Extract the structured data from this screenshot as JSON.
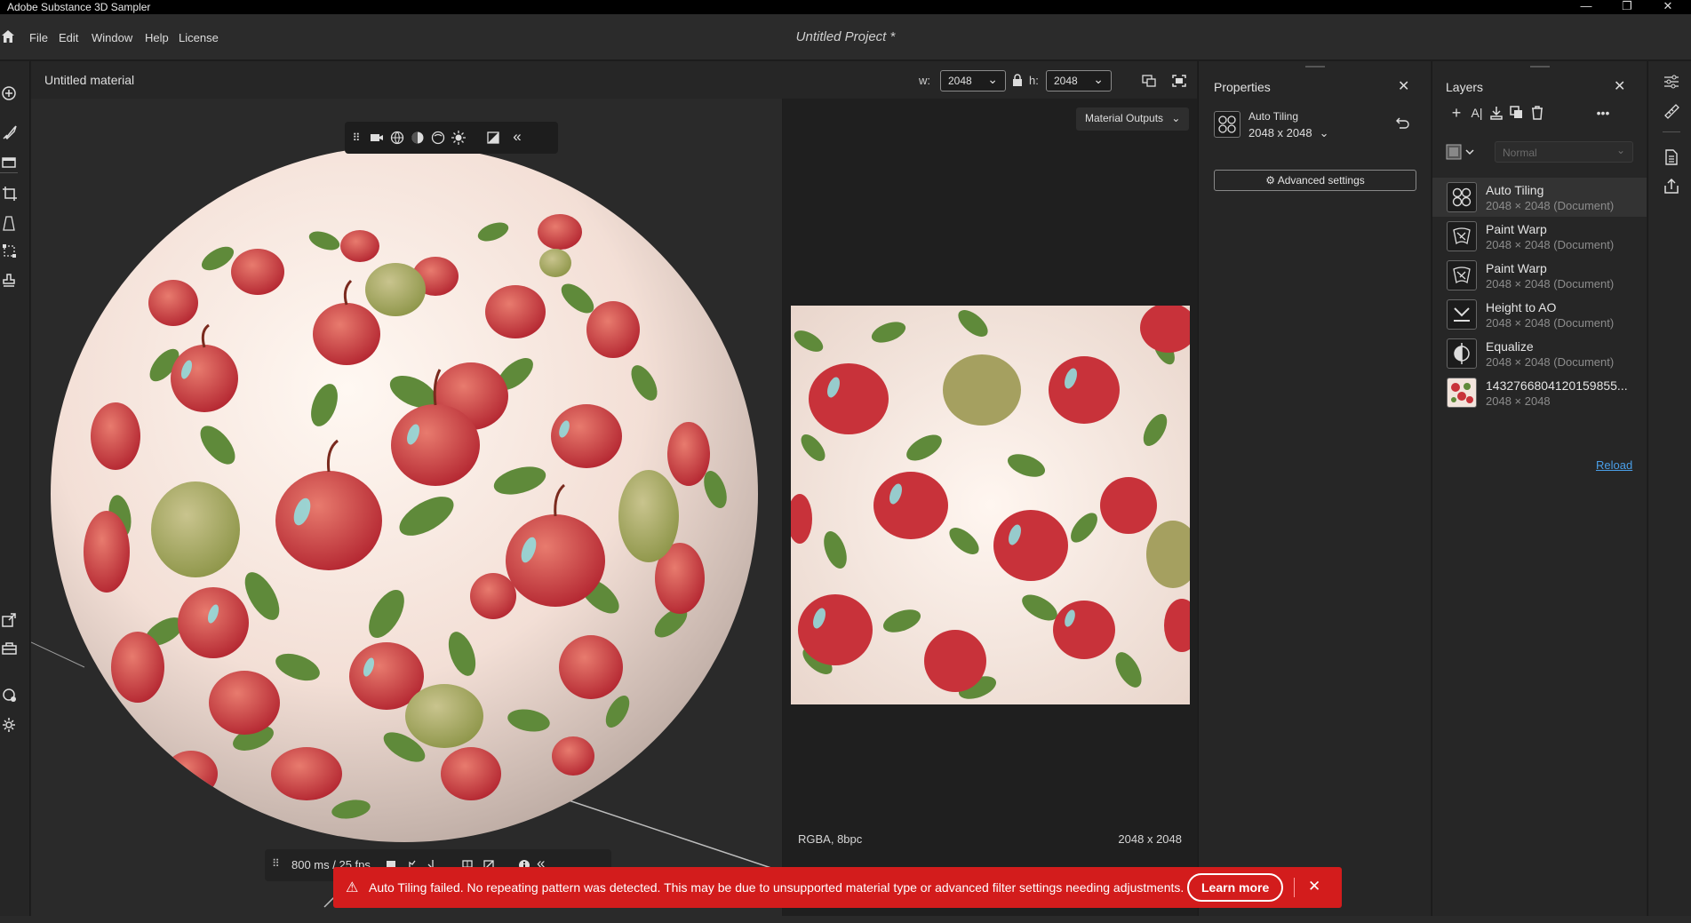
{
  "app": {
    "title": "Adobe Substance 3D Sampler",
    "project_title": "Untitled Project *"
  },
  "window_controls": {
    "minimize": "—",
    "restore": "❐",
    "close": "✕"
  },
  "menu": {
    "items": [
      "File",
      "Edit",
      "Window",
      "Help",
      "License"
    ]
  },
  "viewport": {
    "material_title": "Untitled material",
    "width_label": "w:",
    "width_value": "2048",
    "height_label": "h:",
    "height_value": "2048",
    "fps_readout": "800 ms / 25 fps",
    "collapse_symbol": "«"
  },
  "view2d": {
    "material_outputs": "Material Outputs",
    "format": "RGBA, 8bpc",
    "resolution": "2048 x 2048"
  },
  "properties": {
    "title": "Properties",
    "filter_name": "Auto Tiling",
    "filter_size": "2048 x 2048",
    "advanced_label": "Advanced settings"
  },
  "layers": {
    "title": "Layers",
    "blend_mode": "Normal",
    "items": [
      {
        "name": "Auto Tiling",
        "sub": "2048 × 2048 (Document)",
        "icon": "auto-tiling-icon"
      },
      {
        "name": "Paint Warp",
        "sub": "2048 × 2048 (Document)",
        "icon": "paint-warp-icon"
      },
      {
        "name": "Paint Warp",
        "sub": "2048 × 2048 (Document)",
        "icon": "paint-warp-icon"
      },
      {
        "name": "Height to AO",
        "sub": "2048 × 2048 (Document)",
        "icon": "height-to-ao-icon"
      },
      {
        "name": "Equalize",
        "sub": "2048 × 2048 (Document)",
        "icon": "equalize-icon"
      },
      {
        "name": "1432766804120159855...",
        "sub": "2048 × 2048",
        "icon": "image-thumbnail"
      }
    ],
    "reload_label": "Reload"
  },
  "toast": {
    "message": "Auto Tiling failed. No repeating pattern was detected. This may be due to unsupported material type or advanced filter settings needing adjustments.",
    "learn_more": "Learn more"
  },
  "colors": {
    "toast_bg": "#d31c1c",
    "link": "#4a9fe8",
    "apple_red": "#c8323a",
    "leaf_green": "#5f8a3a"
  }
}
